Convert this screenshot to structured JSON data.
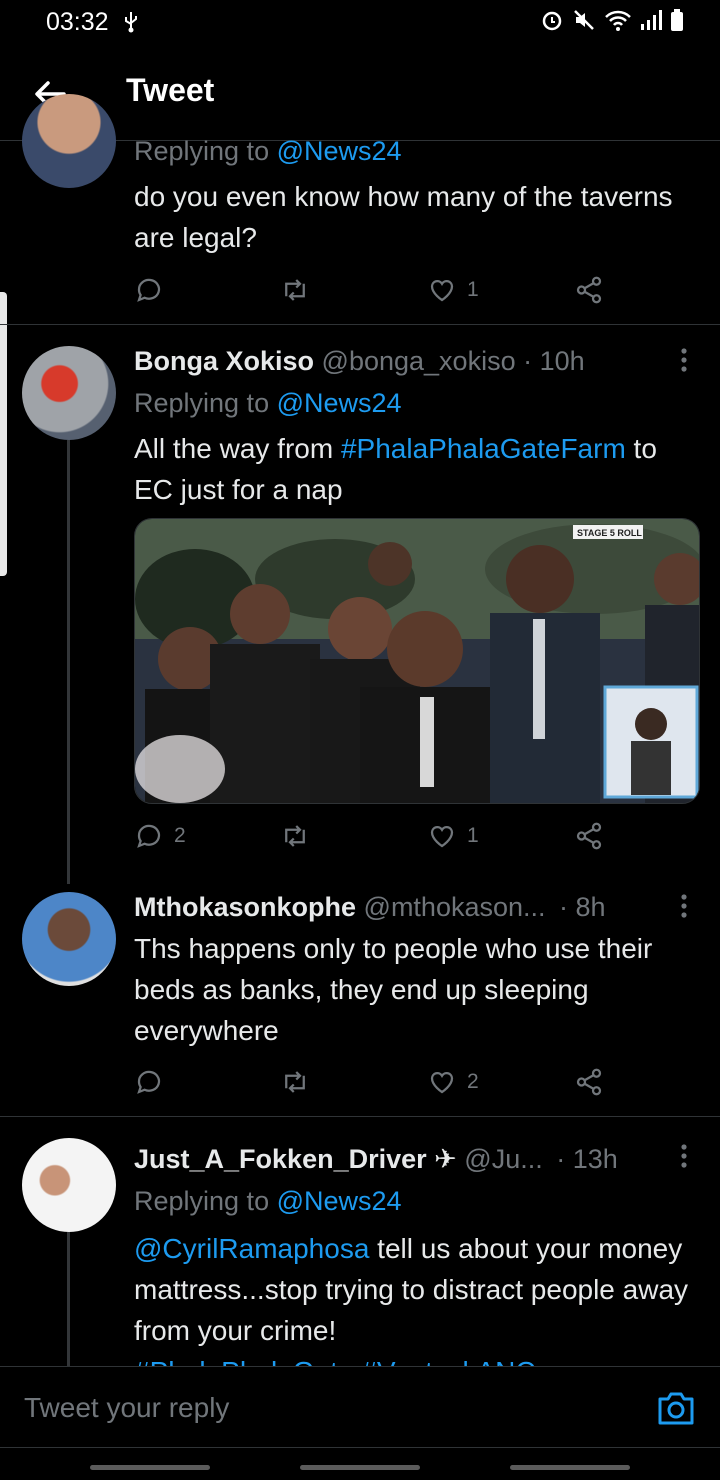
{
  "status_bar": {
    "time": "03:32",
    "icons": [
      "usb-icon",
      "alarm-icon",
      "mute-icon",
      "wifi-icon",
      "signal-icon",
      "battery-icon"
    ]
  },
  "header": {
    "title": "Tweet",
    "back_icon": "arrow-left-icon"
  },
  "tweets": [
    {
      "replying_label": "Replying to",
      "replying_handle": "@News24",
      "text": "do you even know how many of the taverns are legal?",
      "replies": "",
      "retweets": "",
      "likes": "1"
    },
    {
      "name": "Bonga Xokiso",
      "handle": "@bonga_xokiso",
      "time": "· 10h",
      "replying_label": "Replying to",
      "replying_handle": "@News24",
      "text_before": "All the way from ",
      "hashtag": "#PhalaPhalaGateFarm",
      "text_after": " to EC just for a nap",
      "photo_caption": "STAGE 5 ROLL",
      "replies": "2",
      "retweets": "",
      "likes": "1"
    },
    {
      "name": "Mthokasonkophe",
      "handle": "@mthokason...",
      "time": "· 8h",
      "text": "Ths happens  only to people who use their beds as banks, they  end up sleeping everywhere",
      "replies": "",
      "retweets": "",
      "likes": "2"
    },
    {
      "name": "Just_A_Fokken_Driver",
      "name_emoji": "✈",
      "handle": "@Ju...",
      "time": "· 13h",
      "replying_label": "Replying to",
      "replying_handle": "@News24",
      "mention": "@CyrilRamaphosa",
      "text": " tell us about your money mattress...stop trying to distract people away from your crime!",
      "hashtags_cut": "#PhalaPhalaGate #VoetsekANC"
    }
  ],
  "composer": {
    "placeholder": "Tweet your reply",
    "camera_icon": "camera-icon"
  },
  "colors": {
    "background": "#000000",
    "accent": "#1d9bf0",
    "muted": "#71767b",
    "text": "#e7e9ea",
    "divider": "#2f3336"
  }
}
